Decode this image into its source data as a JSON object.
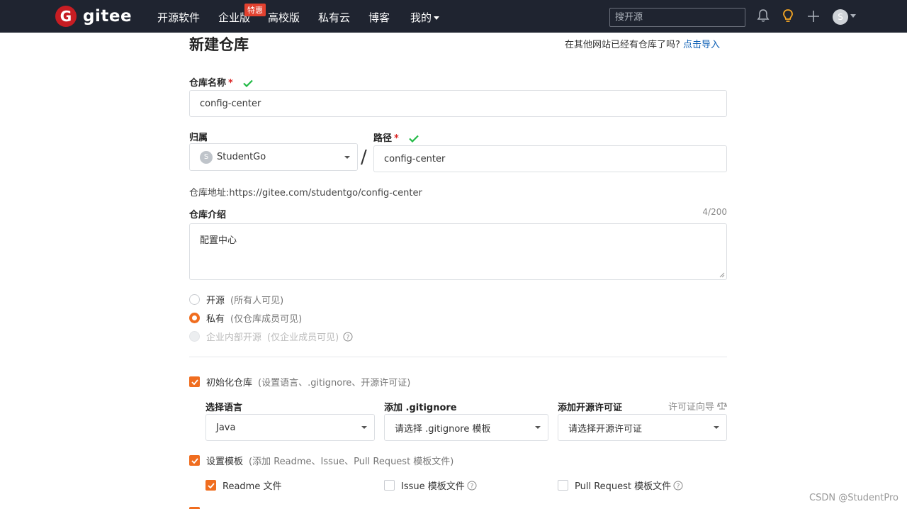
{
  "nav": {
    "logo_mark": "G",
    "logo_text": "gitee",
    "items": [
      "开源软件",
      "企业版",
      "高校版",
      "私有云",
      "博客",
      "我的"
    ],
    "badge": "特惠",
    "search_placeholder": "搜开源",
    "avatar_initial": "S"
  },
  "form": {
    "title": "新建仓库",
    "import_prompt": "在其他网站已经有仓库了吗?",
    "import_link": "点击导入",
    "repo_name_label": "仓库名称",
    "repo_name_required": "*",
    "repo_name_value": "config-center",
    "owner_label": "归属",
    "owner_avatar_initial": "S",
    "owner_value": "StudentGo",
    "separator": "/",
    "path_label": "路径",
    "path_required": "*",
    "path_value": "config-center",
    "repo_url": "仓库地址:https://gitee.com/studentgo/config-center",
    "desc_label": "仓库介绍",
    "desc_counter": "4/200",
    "desc_value": "配置中心",
    "visibility": [
      {
        "label": "开源",
        "note": "(所有人可见)",
        "state": "off"
      },
      {
        "label": "私有",
        "note": "(仅仓库成员可见)",
        "state": "on"
      },
      {
        "label": "企业内部开源",
        "note": "(仅企业成员可见)",
        "state": "disabled"
      }
    ],
    "init_repo_label": "初始化仓库",
    "init_repo_note": "(设置语言、.gitignore、开源许可证)",
    "language_label": "选择语言",
    "language_value": "Java",
    "gitignore_label": "添加 .gitignore",
    "gitignore_value": "请选择 .gitignore 模板",
    "license_label": "添加开源许可证",
    "license_guide": "许可证向导",
    "license_value": "请选择开源许可证",
    "template_label": "设置模板",
    "template_note": "(添加 Readme、Issue、Pull Request 模板文件)",
    "template_files": [
      {
        "label": "Readme 文件",
        "checked": true
      },
      {
        "label": "Issue 模板文件",
        "checked": false
      },
      {
        "label": "Pull Request 模板文件",
        "checked": false
      }
    ]
  },
  "watermark": "CSDN @StudentPro",
  "colors": {
    "accent": "#f06d1f",
    "link": "#095db4",
    "success": "#21ba45",
    "nav_bg": "#1f2430",
    "brand": "#c71d23"
  }
}
